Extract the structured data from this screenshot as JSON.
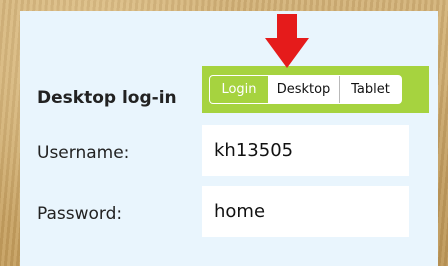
{
  "form": {
    "title": "Desktop log-in",
    "username_label": "Username:",
    "password_label": "Password:",
    "username_value": "kh13505",
    "password_value": "home"
  },
  "mode_toggle": {
    "options": [
      "Login",
      "Desktop",
      "Tablet"
    ],
    "selected": "Login"
  },
  "annotation": {
    "icon": "down-arrow-icon",
    "color": "#e51b1b"
  },
  "colors": {
    "accent": "#a6d33f",
    "panel": "#e9f5fd"
  }
}
